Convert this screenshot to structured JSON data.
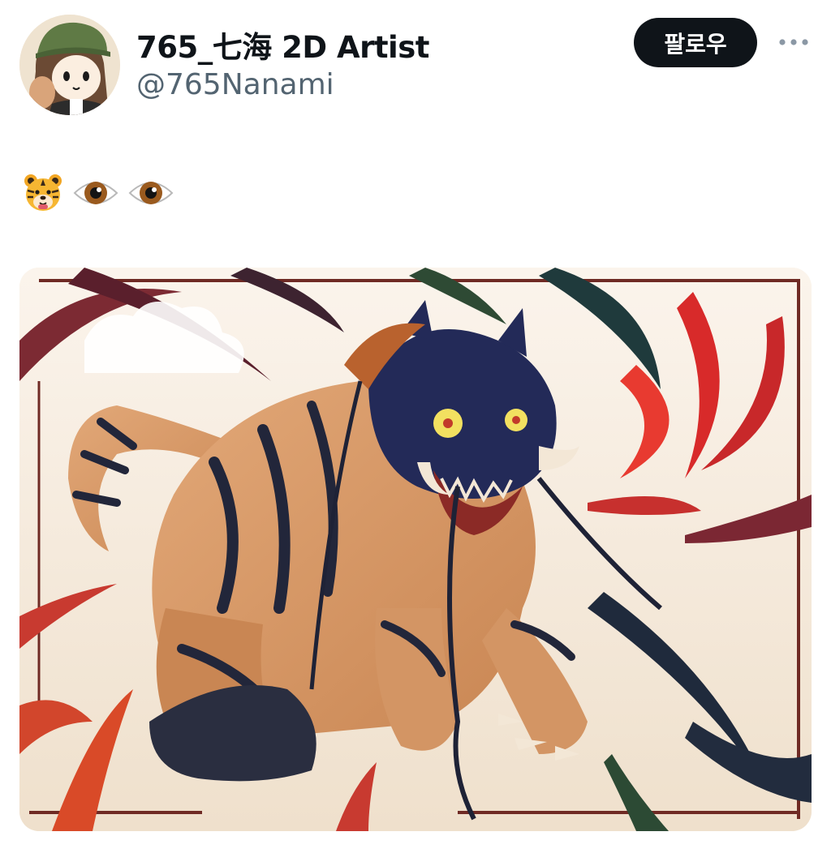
{
  "author": {
    "display_name": "765_七海 2D Artist",
    "handle": "@765Nanami",
    "avatar_icon": "avatar-image"
  },
  "actions": {
    "follow_label": "팔로우",
    "more_icon": "more-options-icon"
  },
  "tweet": {
    "emojis": [
      "tiger-face-emoji",
      "eye-emoji",
      "eye-emoji"
    ]
  },
  "media": {
    "icon": "tiger-illustration-image"
  },
  "colors": {
    "text_primary": "#0f1419",
    "text_secondary": "#536471",
    "follow_bg": "#0f1419",
    "follow_text": "#ffffff"
  }
}
